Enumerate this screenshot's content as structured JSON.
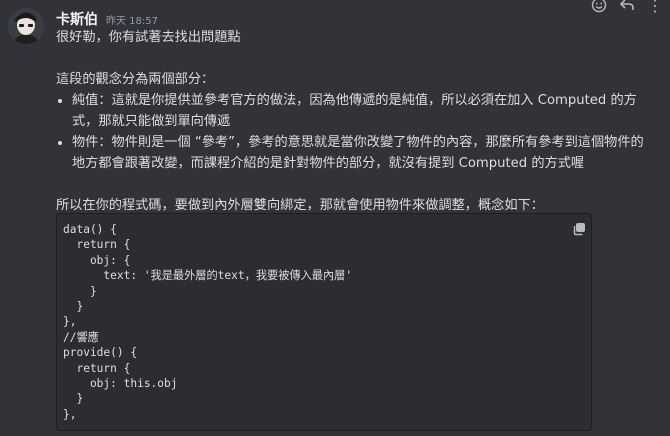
{
  "message": {
    "author": "卡斯伯",
    "timestamp": "昨天 18:57",
    "paragraphs": {
      "greeting": "很好勒，你有試著去找出問題點",
      "intro": "這段的觀念分為兩個部分：",
      "bullets": [
        "純值：這就是你提供並參考官方的做法，因為他傳遞的是純值，所以必須在加入 Computed 的方式，那就只能做到單向傳遞",
        "物件：物件則是一個 “參考”，參考的意思就是當你改變了物件的內容，那麼所有參考到這個物件的地方都會跟著改變，而課程介紹的是針對物件的部分，就沒有提到 Computed 的方式喔"
      ],
      "code_intro": "所以在你的程式碼，要做到內外層雙向綁定，那就會使用物件來做調整，概念如下："
    },
    "code": "data() {\n  return {\n    obj: {\n      text: '我是最外層的text，我要被傳入最內層'\n    }\n  }\n},\n//響應\nprovide() {\n  return {\n    obj: this.obj\n  }\n},"
  },
  "toolbar": {
    "icons": [
      "add-reaction-icon",
      "reply-icon",
      "more-options-icon"
    ],
    "more_glyph": "⋮"
  },
  "codeblock_icon": "copy-icon"
}
